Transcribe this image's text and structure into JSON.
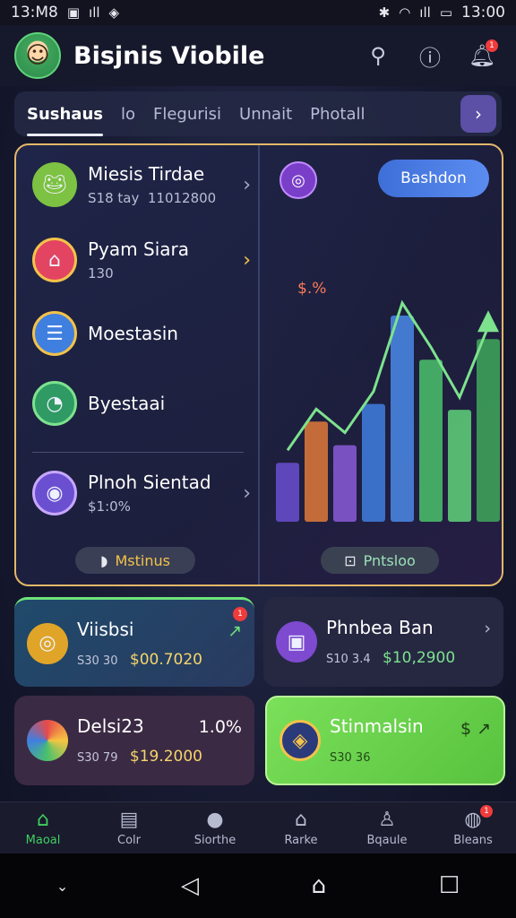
{
  "status_bar": {
    "time": "13:M8",
    "right_time": "13:00"
  },
  "header": {
    "title": "Bisjnis Viobile"
  },
  "tabs": [
    {
      "label": "Sushaus",
      "active": true
    },
    {
      "label": "lo",
      "active": false
    },
    {
      "label": "Flegurisi",
      "active": false
    },
    {
      "label": "Unnait",
      "active": false
    },
    {
      "label": "Photall",
      "active": false
    }
  ],
  "menu": [
    {
      "label": "Miesis Tirdae",
      "sub_a": "S18 tay",
      "sub_b": "11012800",
      "icon": "frog-icon",
      "color": "#7dc242"
    },
    {
      "label": "Pyam Siara",
      "sub_b": "130",
      "icon": "bag-icon",
      "color": "#e24462"
    },
    {
      "label": "Moestasin",
      "icon": "document-icon",
      "color": "#3f7fe0"
    },
    {
      "label": "Byestaai",
      "icon": "clock-icon",
      "color": "#2f9a63"
    },
    {
      "label": "Plnoh Sientad",
      "sub_b": "$1:0%",
      "icon": "shield-icon",
      "color": "#6a4fd0"
    }
  ],
  "hero": {
    "left_pill": "Mstinus",
    "right_pill": "Pntsloo",
    "chart_button": "Bashdon",
    "chart_pct": "$.%"
  },
  "cards": [
    {
      "title": "Viisbsi",
      "small": "S30 30",
      "amount": "$00.7020",
      "side": "↗",
      "icon": "coins-icon",
      "bg": "#1f4a6b"
    },
    {
      "title": "Phnbea Ban",
      "small": "S10 3.4",
      "amount": "$10,2900",
      "side": "›",
      "icon": "wallet-icon",
      "bg": "#262842"
    },
    {
      "title": "Delsi23",
      "small": "S30 79",
      "amount": "$19.2000",
      "side": "1.0%",
      "icon": "globe-icon",
      "bg": "#3b2a44"
    },
    {
      "title": "Stinmalsin",
      "small": "S30 36",
      "amount": "",
      "side": "$ ↗",
      "icon": "badge-icon",
      "bg": "#6fd04a"
    }
  ],
  "bottom_nav": [
    {
      "label": "Maoal",
      "icon": "home-icon",
      "active": true
    },
    {
      "label": "Colr",
      "icon": "list-icon",
      "active": false
    },
    {
      "label": "Siorthe",
      "icon": "chat-icon",
      "active": false
    },
    {
      "label": "Rarke",
      "icon": "bank-icon",
      "active": false
    },
    {
      "label": "Bqaule",
      "icon": "user-icon",
      "active": false
    },
    {
      "label": "Bleans",
      "icon": "bell-icon",
      "active": false
    }
  ],
  "chart_data": {
    "type": "bar",
    "categories": [
      "",
      "",
      "",
      "",
      "",
      "",
      "",
      ""
    ],
    "values": [
      20,
      34,
      26,
      40,
      70,
      55,
      38,
      62
    ]
  }
}
